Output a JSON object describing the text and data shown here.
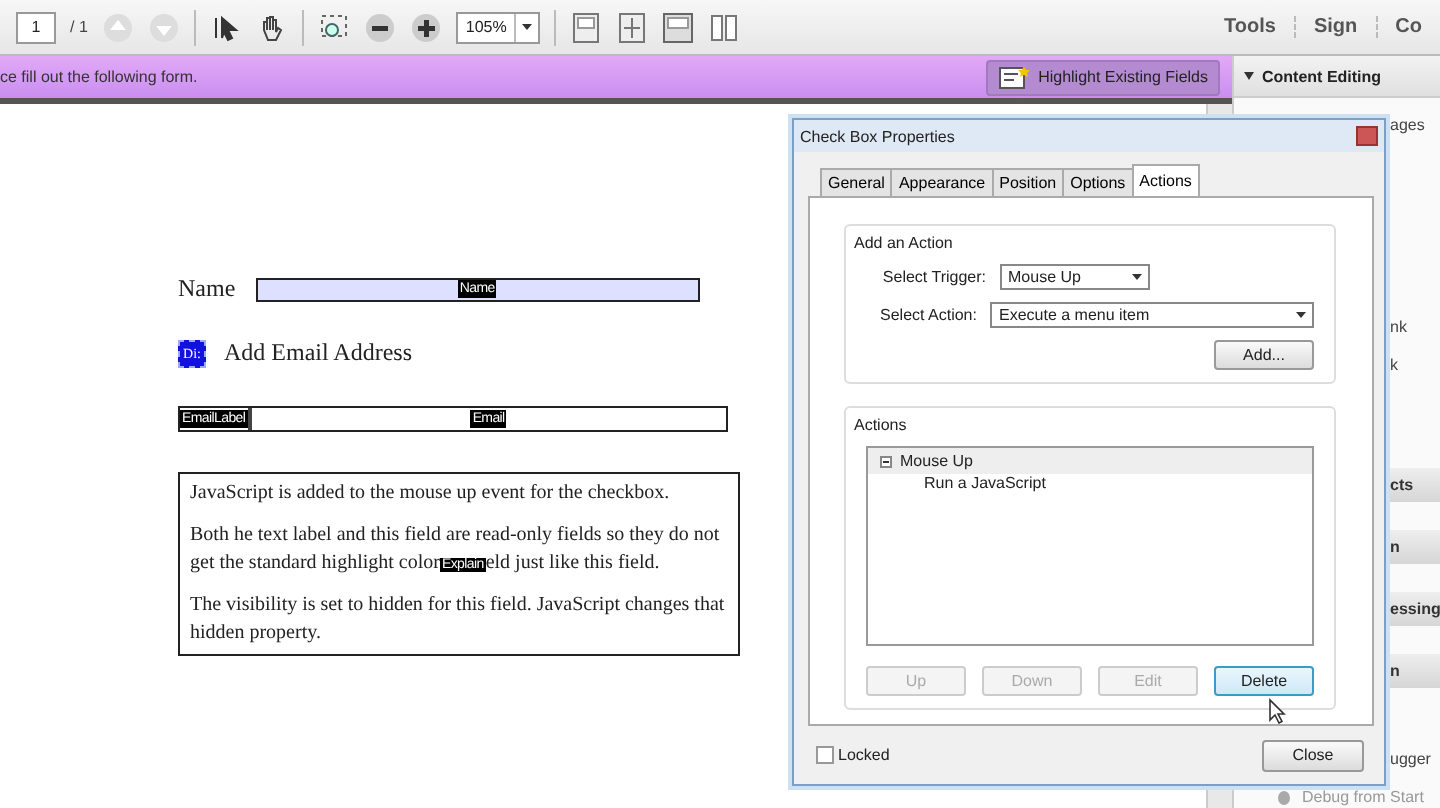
{
  "toolbar": {
    "page": "1",
    "page_total": "/ 1",
    "zoom": "105%",
    "right_tabs": [
      "Tools",
      "Sign",
      "Co"
    ]
  },
  "banner": {
    "message": "ce fill out the following form.",
    "button": "Highlight Existing Fields"
  },
  "document": {
    "name_label": "Name",
    "name_field_tag": "Name",
    "checkbox_tag": "Di:",
    "checkbox_selected": true,
    "checkbox_label": "Add Email Address",
    "email_label_tag": "EmailLabel",
    "email_field_tag": "Email",
    "paragraphs": [
      {
        "text": "JavaScript is added to the mouse up event for the checkbox."
      },
      {
        "lines": [
          "Both he text label and this field are read-only fields so they do not",
          "get the standard highlight color"
        ],
        "tag": "Explain",
        "tail": "eld just like this field."
      },
      {
        "text": "The visibility is set to hidden for this field. JavaScript changes that hidden property."
      }
    ]
  },
  "panel": {
    "header": "Content Editing",
    "groups": [
      {
        "kind": "items",
        "items": [
          "ages"
        ]
      },
      {
        "kind": "items",
        "items": [
          "nk",
          "k"
        ]
      },
      {
        "kind": "sections",
        "items": [
          "cts",
          "n",
          "essing",
          "n"
        ]
      },
      {
        "kind": "items",
        "items": [
          "ugger"
        ]
      },
      {
        "kind": "tools",
        "items": [
          "Debug from Start"
        ]
      }
    ]
  },
  "dialog": {
    "title": "Check Box Properties",
    "tabs": [
      {
        "label": "General",
        "selected": false
      },
      {
        "label": "Appearance",
        "selected": false
      },
      {
        "label": "Position",
        "selected": false
      },
      {
        "label": "Options",
        "selected": false
      },
      {
        "label": "Actions",
        "selected": true
      }
    ],
    "add_group": {
      "title": "Add an Action",
      "trigger_label": "Select Trigger:",
      "trigger_value": "Mouse Up",
      "action_label": "Select Action:",
      "action_value": "Execute a menu item",
      "add_button": "Add..."
    },
    "actions_group": {
      "title": "Actions",
      "tree": [
        {
          "label": "Mouse Up",
          "expanded": true,
          "children": [
            {
              "label": "Run a JavaScript"
            }
          ]
        }
      ],
      "buttons": [
        {
          "label": "Up",
          "disabled": true
        },
        {
          "label": "Down",
          "disabled": true
        },
        {
          "label": "Edit",
          "disabled": true
        },
        {
          "label": "Delete",
          "disabled": false
        }
      ]
    },
    "locked": {
      "label": "Locked",
      "checked": false
    },
    "close_button": "Close"
  }
}
